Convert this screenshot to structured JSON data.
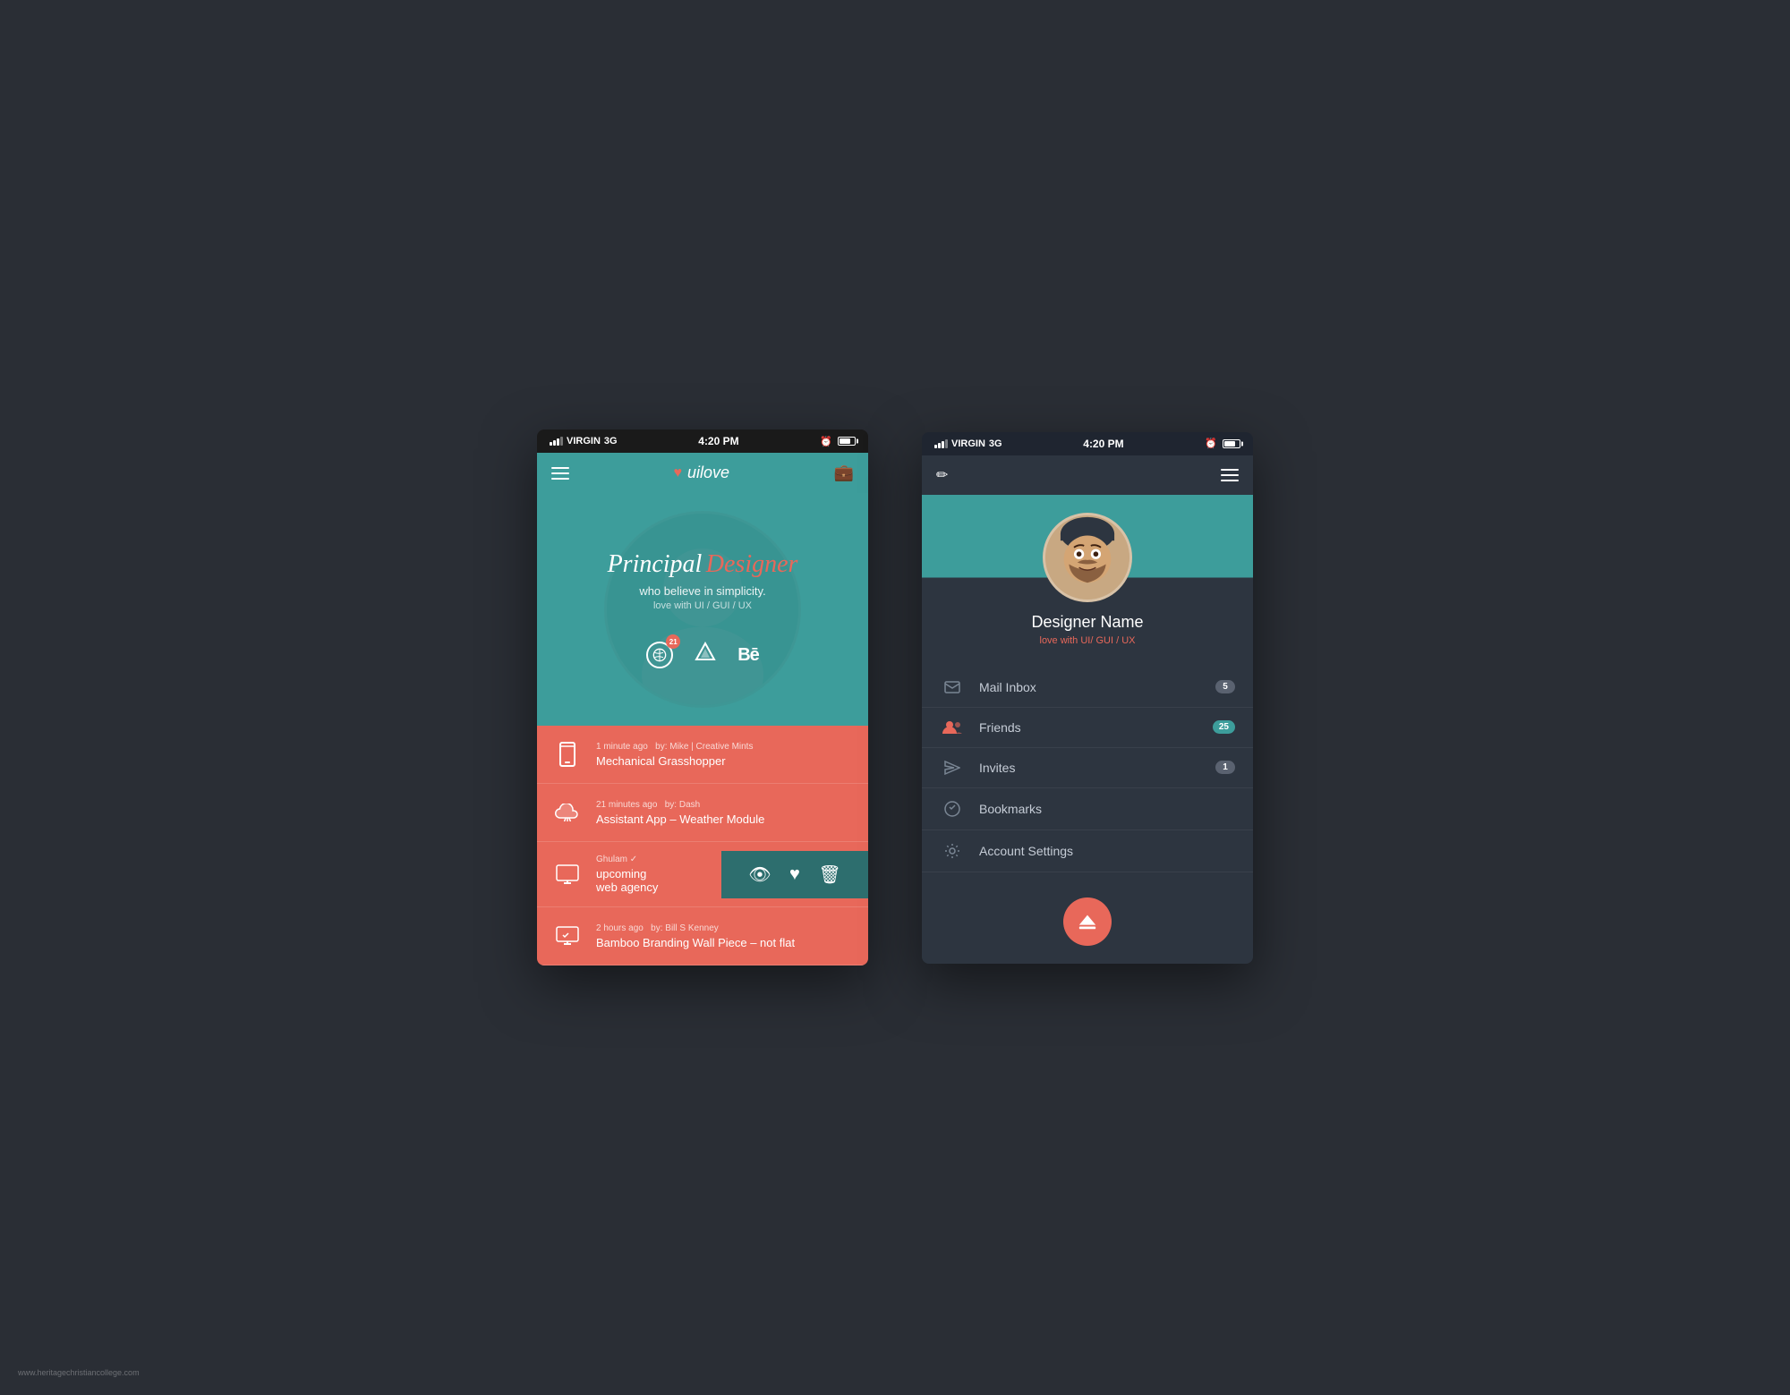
{
  "app": {
    "name": "uilove",
    "watermark": "www.heritagechristiancollege.com"
  },
  "statusBar": {
    "carrier": "VIRGIN",
    "network": "3G",
    "time": "4:20 PM"
  },
  "phone1": {
    "header": {
      "logo": "uilove",
      "hamburger_label": "menu",
      "briefcase_label": "briefcase"
    },
    "hero": {
      "title_plain": "Principal",
      "title_accent": "Designer",
      "subtitle": "who believe in simplicity.",
      "tagline": "love with UI / GUI / UX"
    },
    "social": {
      "dribbble_badge": "21",
      "behance": "Bē"
    },
    "feed": [
      {
        "time": "1 minute ago",
        "by": "by: Mike | Creative Mints",
        "title": "Mechanical Grasshopper",
        "icon": "phone"
      },
      {
        "time": "21 minutes ago",
        "by": "by: Dash",
        "title": "Assistant App – Weather Module",
        "icon": "cloud"
      },
      {
        "time": "",
        "by": "Ghulam ✓",
        "title": "upcoming web agency",
        "icon": "web",
        "has_actions": true
      },
      {
        "time": "2 hours ago",
        "by": "by: Bill S Kenney",
        "title": "Bamboo Branding Wall Piece – not flat",
        "icon": "monitor"
      }
    ]
  },
  "phone2": {
    "header": {
      "pencil_label": "edit",
      "hamburger_label": "menu"
    },
    "profile": {
      "name": "Designer Name",
      "tagline": "love with UI/ GUI / UX"
    },
    "menu": [
      {
        "id": "mail-inbox",
        "label": "Mail Inbox",
        "icon": "mail",
        "badge": "5",
        "badge_type": "gray"
      },
      {
        "id": "friends",
        "label": "Friends",
        "icon": "friends",
        "badge": "25",
        "badge_type": "teal",
        "active": true
      },
      {
        "id": "invites",
        "label": "Invites",
        "icon": "send",
        "badge": "1",
        "badge_type": "gray"
      },
      {
        "id": "bookmarks",
        "label": "Bookmarks",
        "icon": "bookmark",
        "badge": "",
        "badge_type": ""
      },
      {
        "id": "account-settings",
        "label": "Account Settings",
        "icon": "gear",
        "badge": "",
        "badge_type": ""
      }
    ],
    "eject_button_label": "eject"
  }
}
